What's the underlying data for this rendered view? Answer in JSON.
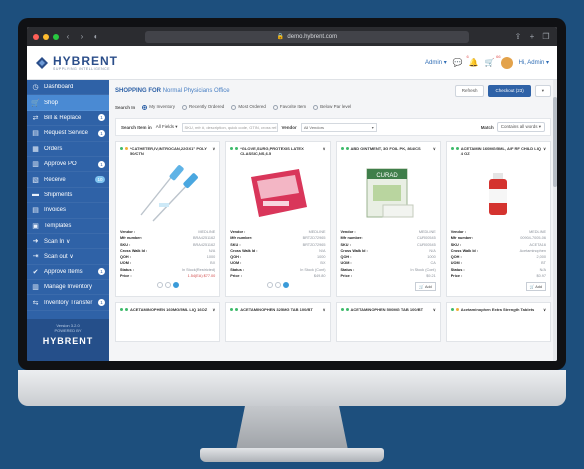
{
  "browser": {
    "url": "demo.hybrent.com"
  },
  "brand": {
    "name": "HYBRENT",
    "tagline": "SUPPLYING INTELLIGENCE"
  },
  "header": {
    "user": "Admin",
    "greeting": "Hi, Admin",
    "notif_count_1": "6",
    "notif_count_2": "66"
  },
  "sidebar": {
    "items": [
      {
        "label": "Dashboard",
        "icon": "dashboard-icon",
        "glyph": "◷",
        "badge": ""
      },
      {
        "label": "Shop",
        "icon": "cart-icon",
        "glyph": "🛒",
        "badge": ""
      },
      {
        "label": "Bill & Replace",
        "icon": "swap-icon",
        "glyph": "⇄",
        "badge": "1"
      },
      {
        "label": "Request Service",
        "icon": "inbox-icon",
        "glyph": "▤",
        "badge": "1"
      },
      {
        "label": "Orders",
        "icon": "document-icon",
        "glyph": "▦",
        "badge": ""
      },
      {
        "label": "Approve PO",
        "icon": "clipboard-icon",
        "glyph": "▥",
        "badge": "1"
      },
      {
        "label": "Receive",
        "icon": "receive-icon",
        "glyph": "▧",
        "badge": "10"
      },
      {
        "label": "Shipments",
        "icon": "truck-icon",
        "glyph": "▬",
        "badge": ""
      },
      {
        "label": "Invoices",
        "icon": "invoice-icon",
        "glyph": "▤",
        "badge": ""
      },
      {
        "label": "Templates",
        "icon": "template-icon",
        "glyph": "▣",
        "badge": ""
      },
      {
        "label": "Scan In ∨",
        "icon": "scan-in-icon",
        "glyph": "➜",
        "badge": ""
      },
      {
        "label": "Scan out ∨",
        "icon": "scan-out-icon",
        "glyph": "⇥",
        "badge": ""
      },
      {
        "label": "Approve Items",
        "icon": "check-icon",
        "glyph": "✔",
        "badge": "1"
      },
      {
        "label": "Manage Inventory",
        "icon": "barcode-icon",
        "glyph": "▥",
        "badge": ""
      },
      {
        "label": "Inventory Transfer",
        "icon": "transfer-icon",
        "glyph": "⇆",
        "badge": "1"
      }
    ],
    "footer_version": "Version 3.2.0",
    "footer_powered": "POWERED BY",
    "footer_logo": "HYBRENT"
  },
  "main": {
    "shop_prefix": "SHOPPING FOR",
    "shop_facility": "Normal Physicians Office",
    "refresh_label": "Refresh",
    "checkout_label": "Checkout (23)",
    "search_in_label": "Search In",
    "radios": [
      {
        "label": "My Inventory",
        "selected": true
      },
      {
        "label": "Recently Ordered",
        "selected": false
      },
      {
        "label": "Most Ordered",
        "selected": false
      },
      {
        "label": "Favorite Item",
        "selected": false
      },
      {
        "label": "Below Par level",
        "selected": false
      }
    ],
    "search_item_label": "Search Item in",
    "all_fields": "All Fields",
    "search_placeholder": "SKU, mfr #, description, quick code, GTIN, cross ref. #",
    "vendor_label": "Vendor",
    "vendor_value": "All Vendors",
    "match_label": "Match",
    "match_value": "Contains all words"
  },
  "field_labels": [
    "Vendor :",
    "Mfr number:",
    "SKU :",
    "Cross Walk Id :",
    "QOH :",
    "UOM :",
    "Status :",
    "Price :"
  ],
  "add_label": "Add",
  "products": [
    {
      "title": "*CATHETER,IV,INTROCAN,22GX1\" POLY 50/CTN",
      "dot": "#f0b03a",
      "image": "catheter",
      "fields": [
        "MEDLINE",
        "BRA4251162",
        "BRA4251162",
        "N/A",
        "1000",
        "BX",
        "In Stock(Restricted)",
        "1.54(EA) $77.00"
      ]
    },
    {
      "title": "*GLOVE,SURG,PROTEXIS LATEX CLASSIC,NS,6.5",
      "dot": "#3fba6b",
      "image": "gloves",
      "fields": [
        "MEDLINE",
        "BRT2D72965",
        "BRT2D72965",
        "N/A",
        "1000",
        "BX",
        "In Stock (Cont)",
        "$49.80"
      ]
    },
    {
      "title": "ABD OINTMENT, 3G FOIL PK, 864/CS",
      "dot": "#3fba6b",
      "image": "ointment",
      "fields": [
        "MEDLINE",
        "CUR00545",
        "CUR00545",
        "N/A",
        "1000",
        "CA",
        "In Stock (Cont)",
        "$9.21"
      ]
    },
    {
      "title": "ACETAMIN 160MG/5ML, A/F RF CHILD LIQ 4 OZ",
      "dot": "#3fba6b",
      "image": "bottle",
      "fields": [
        "MEDLINE",
        "00904-7005-06",
        "ACETA16",
        "Acetaminophen",
        "2,000",
        "BT",
        "N/A",
        "$0.97"
      ]
    },
    {
      "title": "ACETAMINOPHEN 160MG/5ML LIQ 16OZ",
      "dot": "#3fba6b",
      "image": "",
      "fields": []
    },
    {
      "title": "ACETAMINOPHEN 325MG TAB 100/BT",
      "dot": "#3fba6b",
      "image": "",
      "fields": []
    },
    {
      "title": "ACETAMINOPHEN 500MG TAB 100/BT",
      "dot": "#3fba6b",
      "image": "",
      "fields": []
    },
    {
      "title": "Acetaminophen Extra Strength Tablets",
      "dot": "#f0b03a",
      "image": "",
      "fields": []
    }
  ],
  "colors": {
    "brand_blue": "#2f62a7",
    "active_blue": "#4a8ad3",
    "background": "#1d4f7d"
  }
}
